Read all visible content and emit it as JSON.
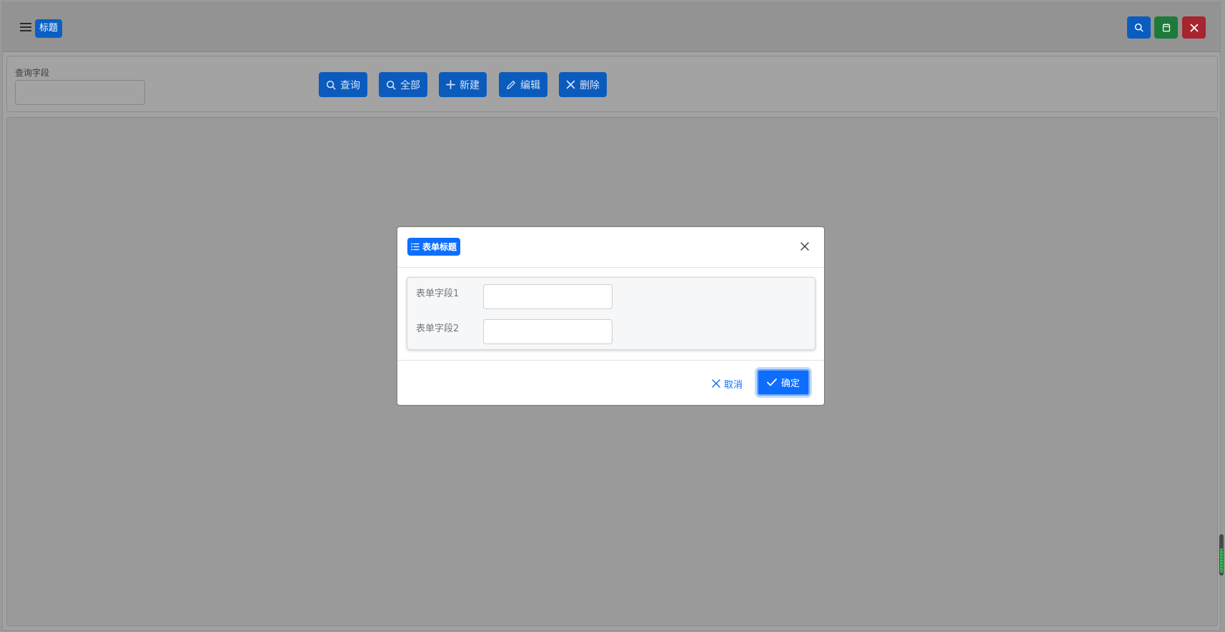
{
  "topbar": {
    "title": "标题",
    "buttons": [
      {
        "icon": "search-icon",
        "color": "#0a5cc0"
      },
      {
        "icon": "calendar-icon",
        "color": "#1e7a3a"
      },
      {
        "icon": "close-icon",
        "color": "#a8242f"
      }
    ]
  },
  "query": {
    "field_label": "查询字段",
    "field_value": "",
    "buttons": {
      "search": "查询",
      "all": "全部",
      "new": "新建",
      "edit": "编辑",
      "delete": "删除"
    }
  },
  "modal": {
    "title": "表单标题",
    "fields": [
      {
        "label": "表单字段1",
        "value": ""
      },
      {
        "label": "表单字段2",
        "value": ""
      }
    ],
    "cancel_label": "取消",
    "confirm_label": "确定",
    "accent_color": "#0d6efd"
  }
}
